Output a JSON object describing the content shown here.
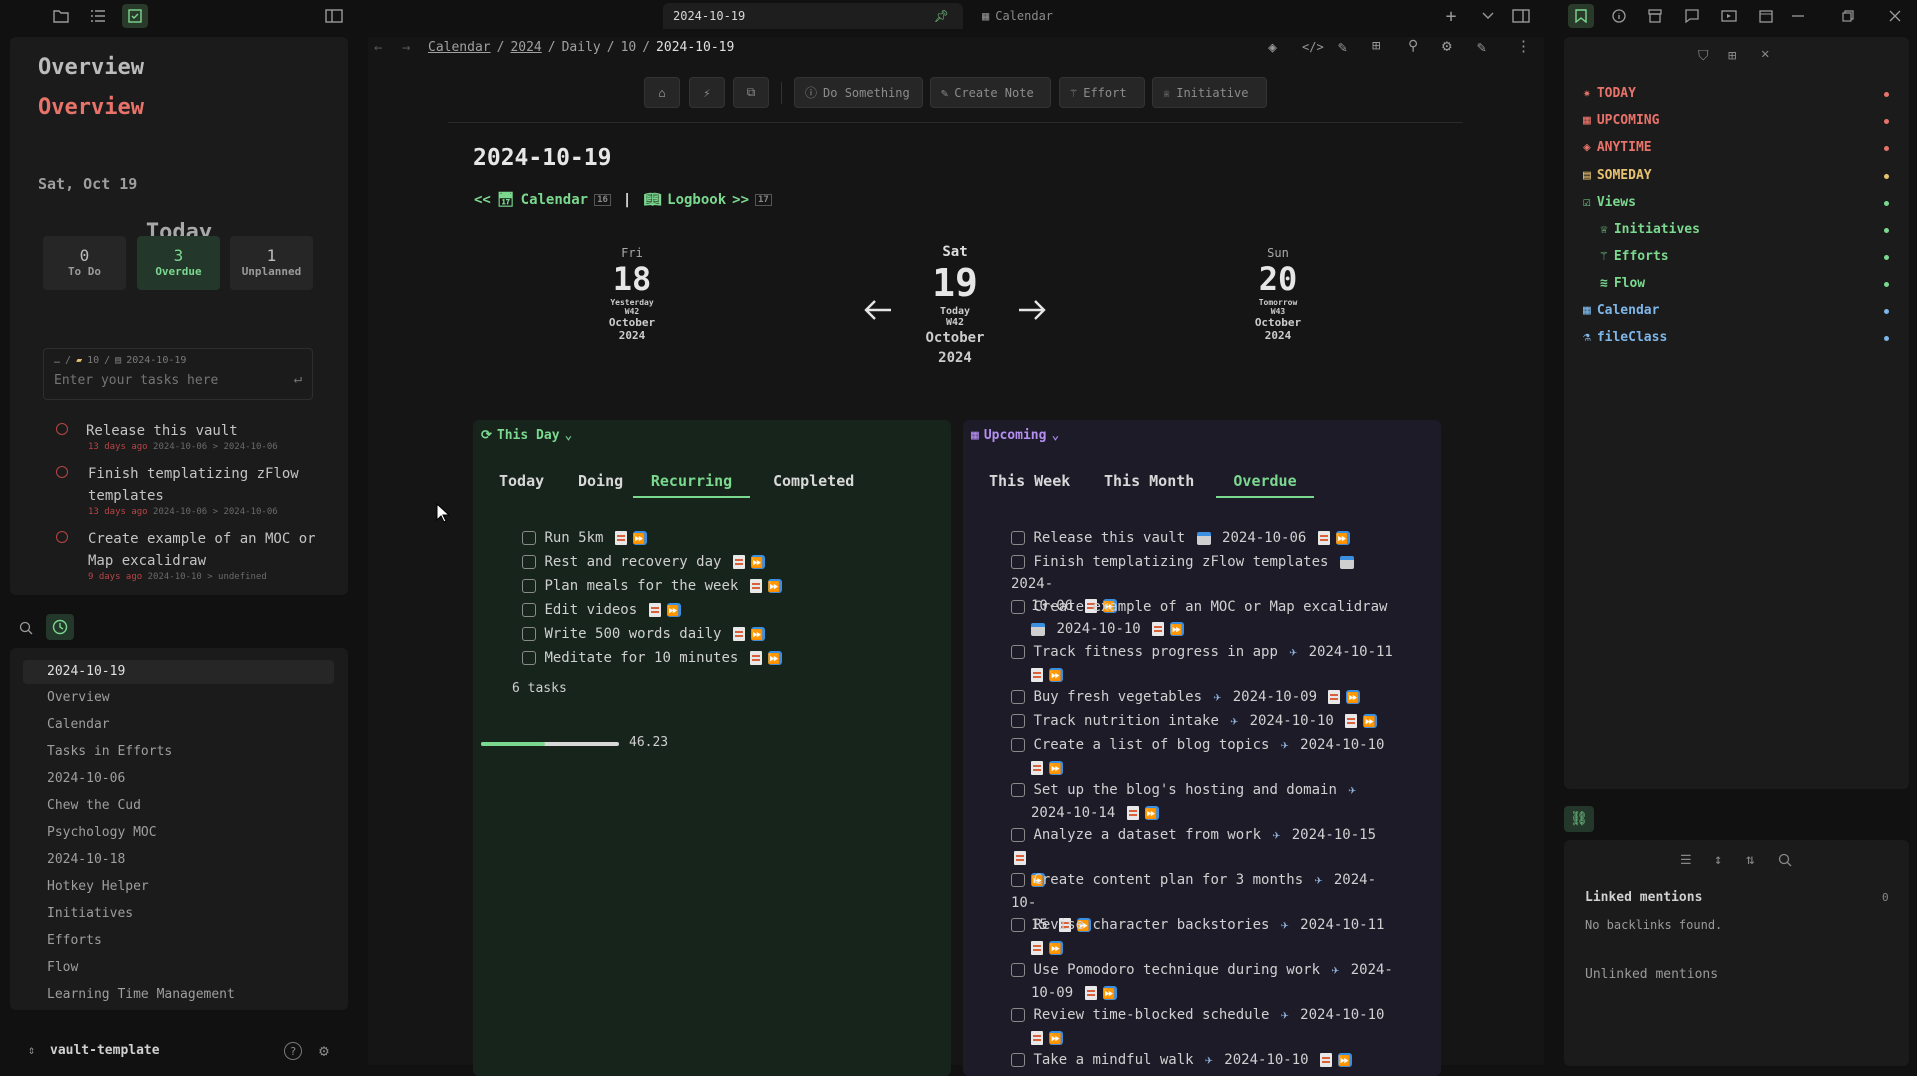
{
  "titlebar": {
    "active_tab": "2024-10-19",
    "second_tab": "Calendar"
  },
  "left": {
    "heading1": "Overview",
    "heading2": "Overview",
    "date": "Sat, Oct 19",
    "today_label": "Today",
    "stats": [
      {
        "n": "0",
        "label": "To Do"
      },
      {
        "n": "3",
        "label": "Overdue"
      },
      {
        "n": "1",
        "label": "Unplanned"
      }
    ],
    "input_path": {
      "root": "…",
      "folder": "10",
      "file": "2024-10-19"
    },
    "input_placeholder": "Enter your tasks here",
    "tasks": [
      {
        "title": "Release this vault",
        "ago": "13 days ago",
        "range": "2024-10-06 > 2024-10-06"
      },
      {
        "title": "Finish templatizing zFlow templates",
        "ago": "13 days ago",
        "range": "2024-10-06 > 2024-10-06"
      },
      {
        "title": "Create example of an MOC or Map excalidraw",
        "ago": "9 days ago",
        "range": "2024-10-10 > undefined"
      }
    ],
    "files": [
      "2024-10-19",
      "Overview",
      "Calendar",
      "Tasks in Efforts",
      "2024-10-06",
      "Chew the Cud",
      "Psychology MOC",
      "2024-10-18",
      "Hotkey Helper",
      "Initiatives",
      "Efforts",
      "Flow",
      "Learning Time Management"
    ],
    "vault": "vault-template"
  },
  "main": {
    "breadcrumb": [
      "Calendar",
      "2024",
      "Daily",
      "10",
      "2024-10-19"
    ],
    "toolbar": [
      "Do Something",
      "Create Note",
      "Effort",
      "Initiative"
    ],
    "title": "2024-10-19",
    "nav": {
      "calendar": "Calendar",
      "calendar_count": "16",
      "sep": "|",
      "logbook": "Logbook",
      "logbook_count": "17"
    },
    "days": {
      "prev": {
        "dow": "Fri",
        "num": "18",
        "rel": "Yesterday",
        "week": "W42",
        "month": "October",
        "year": "2024"
      },
      "cur": {
        "dow": "Sat",
        "num": "19",
        "rel": "Today",
        "week": "W42",
        "month": "October",
        "year": "2024"
      },
      "next": {
        "dow": "Sun",
        "num": "20",
        "rel": "Tomorrow",
        "week": "W43",
        "month": "October",
        "year": "2024"
      }
    },
    "thisday": {
      "title": "This Day",
      "tabs": [
        "Today",
        "Doing",
        "Recurring",
        "Completed"
      ],
      "tasks": [
        "Run 5km",
        "Rest and recovery day",
        "Plan meals for the week",
        "Edit videos",
        "Write 500 words daily",
        "Meditate for 10 minutes"
      ],
      "count": "6 tasks",
      "progress_value": "46.23",
      "progress": 0.4623
    },
    "upcoming": {
      "title": "Upcoming",
      "tabs": [
        "This Week",
        "This Month",
        "Overdue"
      ],
      "tasks": [
        {
          "a": "Release this vault",
          "b": "2024-10-06"
        },
        {
          "a": "Finish templatizing zFlow templates",
          "b": "2024-",
          "c": "10-06"
        },
        {
          "a": "Create example of an MOC or Map excalidraw",
          "b": "2024-10-10"
        },
        {
          "a": "Track fitness progress in app",
          "b": "2024-10-11"
        },
        {
          "a": "Buy fresh vegetables",
          "b": "2024-10-09"
        },
        {
          "a": "Track nutrition intake",
          "b": "2024-10-10"
        },
        {
          "a": "Create a list of blog topics",
          "b": "2024-10-10"
        },
        {
          "a": "Set up the blog's hosting and domain",
          "b": "2024-10-14"
        },
        {
          "a": "Analyze a dataset from work",
          "b": "2024-10-15"
        },
        {
          "a": "Create content plan for 3 months",
          "b": "2024-10-",
          "c": "15"
        },
        {
          "a": "Revise character backstories",
          "b": "2024-10-11"
        },
        {
          "a": "Use Pomodoro technique during work",
          "b": "2024-",
          "c": "10-09"
        },
        {
          "a": "Review time-blocked schedule",
          "b": "2024-10-10"
        },
        {
          "a": "Take a mindful walk",
          "b": "2024-10-10"
        }
      ]
    }
  },
  "right": {
    "nav": [
      {
        "label": "TODAY",
        "color": "#e8736a"
      },
      {
        "label": "UPCOMING",
        "color": "#e8736a"
      },
      {
        "label": "ANYTIME",
        "color": "#e8736a"
      },
      {
        "label": "SOMEDAY",
        "color": "#e8c170"
      },
      {
        "label": "Views",
        "color": "#7bd88f"
      },
      {
        "label": "Initiatives",
        "color": "#7bd88f"
      },
      {
        "label": "Efforts",
        "color": "#7bd88f"
      },
      {
        "label": "Flow",
        "color": "#7bd88f"
      },
      {
        "label": "Calendar",
        "color": "#7fb6e8"
      },
      {
        "label": "fileClass",
        "color": "#7fb6e8"
      }
    ],
    "linked": "Linked mentions",
    "linked_count": "0",
    "no_backlinks": "No backlinks found.",
    "unlinked": "Unlinked mentions"
  }
}
